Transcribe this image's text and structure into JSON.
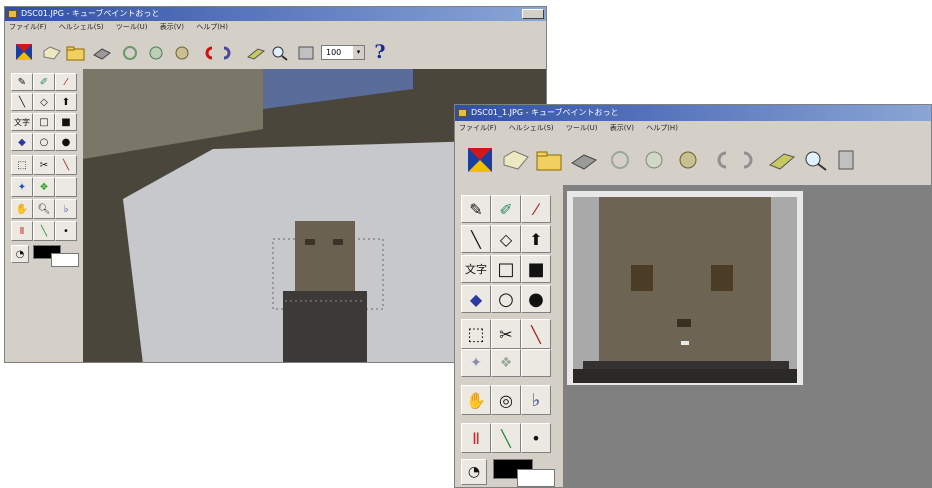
{
  "back_window": {
    "title": "DSC01.JPG - キューブペイントおっと",
    "menu": [
      "ファイル(F)",
      "ヘルシェル(S)",
      "ツール(U)",
      "表示(V)",
      "ヘルプ(H)"
    ],
    "zoom_value": "100",
    "help_glyph": "?",
    "text_tool_label": "文字",
    "toolbar_icons": [
      "new-icon",
      "open-icon",
      "save-icon",
      "print-icon",
      "rotate-icon",
      "undo-icon",
      "redo-icon",
      "copy-icon",
      "zoom-icon",
      "grid-icon"
    ],
    "photo_description_colors": {
      "floor": "#4a4438",
      "paper": "#c9cacd",
      "usb_body": "#3b3a36",
      "usb_plug": "#6b6150"
    }
  },
  "front_window": {
    "title": "DSC01_1.JPG - キューブペイントおっと",
    "menu": [
      "ファイル(F)",
      "ヘルシェル(S)",
      "ツール(U)",
      "表示(V)",
      "ヘルプ(H)"
    ],
    "text_tool_label": "文字",
    "toolbar_icons": [
      "new-icon",
      "open-icon",
      "save-icon",
      "print-icon",
      "rotate-icon",
      "undo-icon",
      "redo-icon",
      "copy-icon",
      "zoom-icon",
      "grid-icon"
    ],
    "canvas_bg": "#808080"
  },
  "caption": "",
  "colors": {
    "chrome": "#d4d0c8",
    "title_start": "#2f4fa6",
    "title_end": "#8aa6d6"
  }
}
